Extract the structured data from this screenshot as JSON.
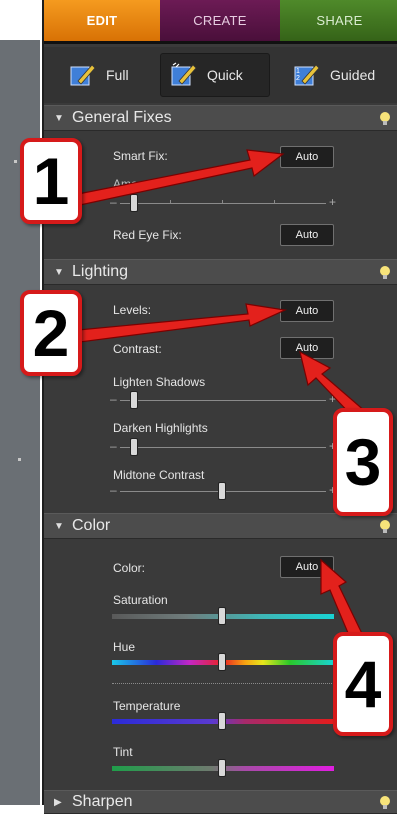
{
  "mode_tabs": [
    {
      "label": "EDIT",
      "active": true
    },
    {
      "label": "CREATE",
      "active": false
    },
    {
      "label": "SHARE",
      "active": false
    }
  ],
  "views": [
    {
      "label": "Full",
      "icon": "full-edit-icon",
      "active": false
    },
    {
      "label": "Quick",
      "icon": "quick-edit-icon",
      "active": true
    },
    {
      "label": "Guided",
      "icon": "guided-edit-icon",
      "active": false
    }
  ],
  "sections": {
    "general_fixes": {
      "title": "General Fixes",
      "smart_fix_label": "Smart Fix:",
      "smart_fix_button": "Auto",
      "amount_label": "Amount",
      "red_eye_label": "Red Eye Fix:",
      "red_eye_button": "Auto"
    },
    "lighting": {
      "title": "Lighting",
      "levels_label": "Levels:",
      "levels_button": "Auto",
      "contrast_label": "Contrast:",
      "contrast_button": "Auto",
      "lighten_shadows_label": "Lighten Shadows",
      "darken_highlights_label": "Darken Highlights",
      "midtone_contrast_label": "Midtone Contrast"
    },
    "color": {
      "title": "Color",
      "color_label": "Color:",
      "color_button": "Auto",
      "saturation_label": "Saturation",
      "hue_label": "Hue",
      "temperature_label": "Temperature",
      "tint_label": "Tint"
    },
    "sharpen": {
      "title": "Sharpen"
    }
  },
  "sliders": {
    "amount": 0.0,
    "lighten_shadows": 0.0,
    "darken_highlights": 0.0,
    "midtone_contrast": 0.5,
    "saturation": 0.5,
    "hue": 0.5,
    "temperature": 0.5,
    "tint": 0.5
  },
  "callouts": [
    {
      "number": "1"
    },
    {
      "number": "2"
    },
    {
      "number": "3"
    },
    {
      "number": "4"
    }
  ],
  "colors": {
    "edit_tab": "#f08a12",
    "create_tab": "#5a1447",
    "share_tab": "#437a22",
    "panel_bg": "#3a3a3a",
    "callout_red": "#d61a1a"
  }
}
